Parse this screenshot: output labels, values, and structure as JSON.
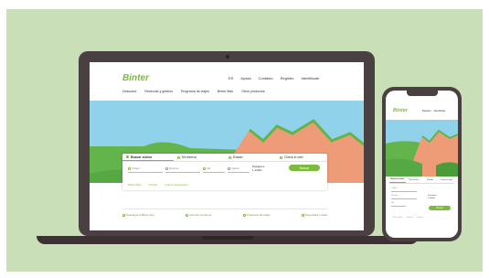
{
  "brand": {
    "name": "Binter",
    "accent": "#7dbb3c",
    "sky": "#8fd2ea",
    "hills": "#62b44b",
    "mountains": "#ee9b77"
  },
  "header": {
    "top_links": [
      "ES",
      "Ayuda",
      "Contacto",
      "Registro",
      "Identifícate"
    ],
    "nav": [
      "Descubre",
      "Reservas y gestión",
      "Programa de viajes",
      "Binter Más",
      "Otros productos"
    ]
  },
  "search": {
    "tabs": [
      "Buscar vuelos",
      "Mi reserva",
      "Estado",
      "Check-in web"
    ],
    "from_placeholder": "Origen",
    "to_placeholder": "Destino",
    "date_out": "Ida",
    "date_back": "Vuelta",
    "passengers_label": "Pasajeros",
    "passengers_value": "1 adulto",
    "submit_label": "Buscar",
    "links": [
      "Binter Más",
      "Ofertas",
      "Vuelos destacados"
    ]
  },
  "promos": [
    "Descarga la Binter App",
    "Atención al cliente",
    "Programa de viajes",
    "Seguridad y salud"
  ],
  "mobile": {
    "top": [
      "Registro",
      "Identifícate"
    ],
    "tabs": [
      "Buscar vuelos",
      "Mi reserva",
      "Estado",
      "Check-in web"
    ],
    "from_placeholder": "Origen",
    "to_placeholder": "Destino",
    "date_out": "Ida",
    "passengers_label": "Pasajeros",
    "passengers_value": "1 adulto",
    "submit_label": "Buscar",
    "links": [
      "Binter Más",
      "Ofertas",
      "Vuelos"
    ]
  }
}
